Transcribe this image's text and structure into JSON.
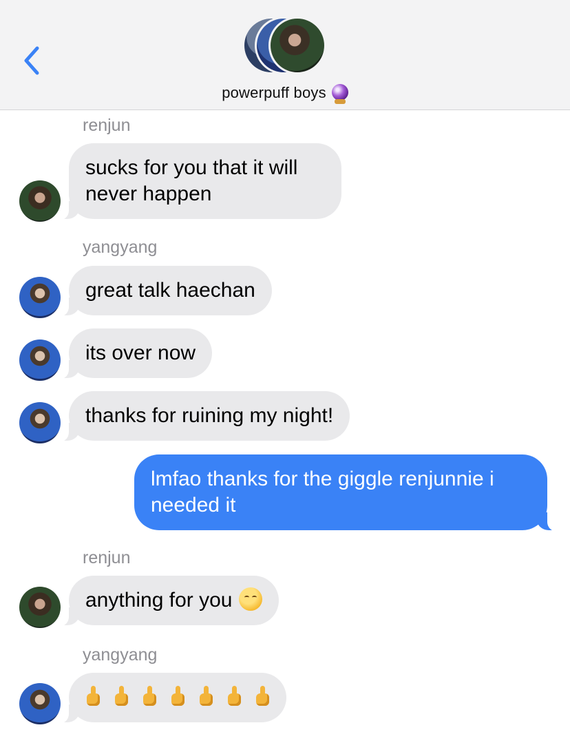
{
  "header": {
    "back_label": "‹",
    "group_name": "powerpuff boys",
    "group_emoji_icon": "crystal-ball-icon"
  },
  "messages": [
    {
      "type": "sender",
      "text": "renjun"
    },
    {
      "type": "in",
      "sender": "renjun",
      "text": "sucks for you that it will never happen"
    },
    {
      "type": "sender",
      "text": "yangyang"
    },
    {
      "type": "in",
      "sender": "yangyang",
      "text": "great talk haechan"
    },
    {
      "type": "in",
      "sender": "yangyang",
      "text": "its over now"
    },
    {
      "type": "in",
      "sender": "yangyang",
      "text": "thanks for ruining my night!"
    },
    {
      "type": "out",
      "text": "lmfao thanks for the giggle renjunnie i needed it"
    },
    {
      "type": "sender",
      "text": "renjun"
    },
    {
      "type": "in",
      "sender": "renjun",
      "text": "anything for you",
      "emoji_icon": "kissing-face-icon"
    },
    {
      "type": "sender",
      "text": "yangyang"
    },
    {
      "type": "in",
      "sender": "yangyang",
      "text": "",
      "emoji_icon": "middle-finger-icon",
      "emoji_count": 7
    }
  ]
}
